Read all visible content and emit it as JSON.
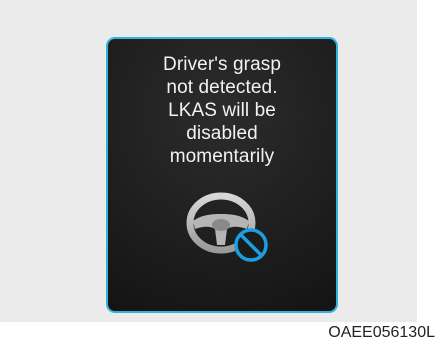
{
  "display": {
    "message": "Driver's grasp\nnot detected.\nLKAS will be\ndisabled\nmomentarily",
    "icon": "steering-wheel-prohibited-icon",
    "border_color": "#33b2e0",
    "prohibit_color": "#1a9fe0"
  },
  "figure_code": "OAEE056130L"
}
